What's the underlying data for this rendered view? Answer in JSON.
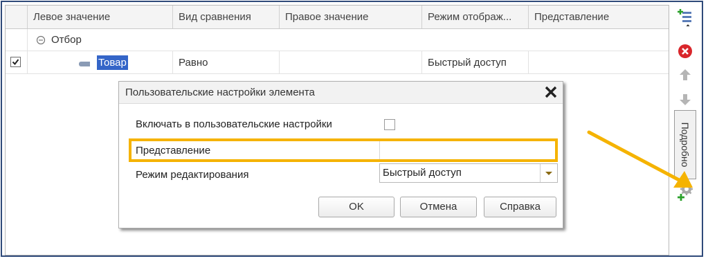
{
  "grid": {
    "columns": [
      "Левое значение",
      "Вид сравнения",
      "Правое значение",
      "Режим отображ...",
      "Представление"
    ],
    "group_row": {
      "label": "Отбор"
    },
    "data_row": {
      "checked": true,
      "left_value": "Товар",
      "comparison": "Равно",
      "right_value": "",
      "display_mode": "Быстрый доступ",
      "presentation": ""
    }
  },
  "toolbar": {
    "details_label": "Подробно",
    "icons": [
      "add-list-icon",
      "delete-icon",
      "move-up-icon",
      "move-down-icon",
      "add-settings-icon"
    ]
  },
  "dialog": {
    "title": "Пользовательские настройки элемента",
    "include_label": "Включать в пользовательские настройки",
    "include_checked": false,
    "presentation_label": "Представление",
    "presentation_value": "",
    "edit_mode_label": "Режим редактирования",
    "edit_mode_value": "Быстрый доступ",
    "ok_label": "OK",
    "cancel_label": "Отмена",
    "help_label": "Справка"
  },
  "colors": {
    "highlight": "#f5b300",
    "selection": "#3465c8",
    "arrow": "#f5b300",
    "frame": "#2f4a7a"
  }
}
